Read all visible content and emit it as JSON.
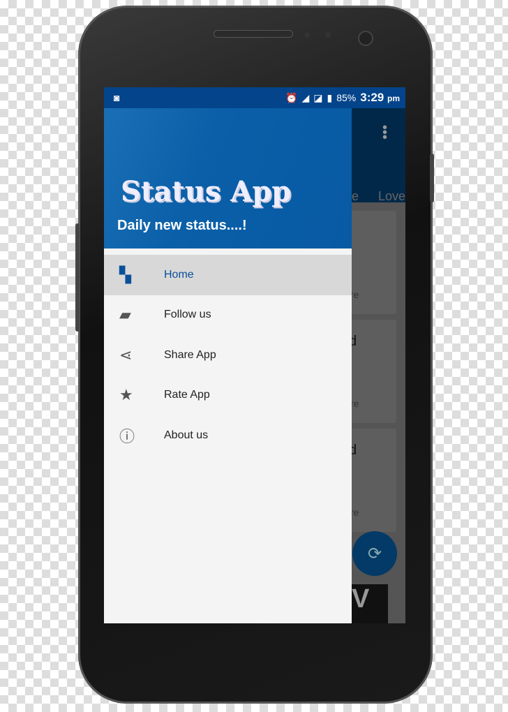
{
  "status_bar": {
    "battery": "85%",
    "time": "3:29",
    "ampm": "pm",
    "icons": [
      "cyanogen-icon",
      "alarm-icon",
      "signal-h-icon",
      "no-sim-icon",
      "battery-charging-icon"
    ]
  },
  "background_app": {
    "tabs": [
      "e",
      "Love"
    ],
    "cards": [
      {
        "title": "d",
        "action": "re"
      },
      {
        "title": "d",
        "action": "re"
      },
      {
        "title": "d",
        "action": "re"
      }
    ],
    "fab_icon": "refresh-icon",
    "ad_letter": "V"
  },
  "drawer": {
    "title": "Status App",
    "subtitle": "Daily new status....!",
    "items": [
      {
        "label": "Home",
        "icon": "dashboard-icon",
        "active": true
      },
      {
        "label": "Follow us",
        "icon": "forum-icon"
      },
      {
        "label": "Share App",
        "icon": "share-icon"
      },
      {
        "label": "Rate App",
        "icon": "star-icon"
      },
      {
        "label": "About us",
        "icon": "info-icon"
      }
    ]
  },
  "colors": {
    "primary": "#0a5fa8",
    "status_bar": "#03448a",
    "active_text": "#0a4f9a"
  }
}
